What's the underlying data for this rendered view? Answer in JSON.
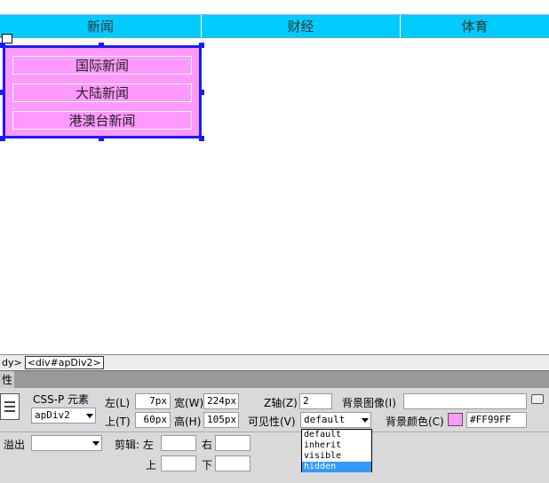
{
  "menubar": {
    "items": [
      "新闻",
      "财经",
      "体育"
    ]
  },
  "apdiv": {
    "items": [
      "国际新闻",
      "大陆新闻",
      "港澳台新闻"
    ]
  },
  "tagbar": {
    "prefix": "dy>",
    "selected_tag": "<div#apDiv2>"
  },
  "panel": {
    "tab_label": "性",
    "element_type_label": "CSS-P 元素",
    "element_id": "apDiv2",
    "left_label": "左(L)",
    "left_value": "7px",
    "width_label": "宽(W)",
    "width_value": "224px",
    "top_label": "上(T)",
    "top_value": "60px",
    "height_label": "高(H)",
    "height_value": "105px",
    "zindex_label": "Z轴(Z)",
    "zindex_value": "2",
    "visibility_label": "可见性(V)",
    "visibility_value": "default",
    "bgimage_label": "背景图像(I)",
    "bgcolor_label": "背景颜色(C)",
    "bgcolor_value": "#FF99FF",
    "overflow_label": "溢出",
    "clip_label": "剪辑: 左",
    "clip_right": "右",
    "clip_top": "上",
    "clip_bottom": "下",
    "visibility_options": [
      "default",
      "inherit",
      "visible",
      "hidden"
    ],
    "visibility_highlighted": "hidden"
  },
  "colors": {
    "menubar_bg": "#00ccff",
    "apdiv_bg": "#FF99FF",
    "apdiv_border": "#1a1aff",
    "highlight": "#3399ff"
  }
}
